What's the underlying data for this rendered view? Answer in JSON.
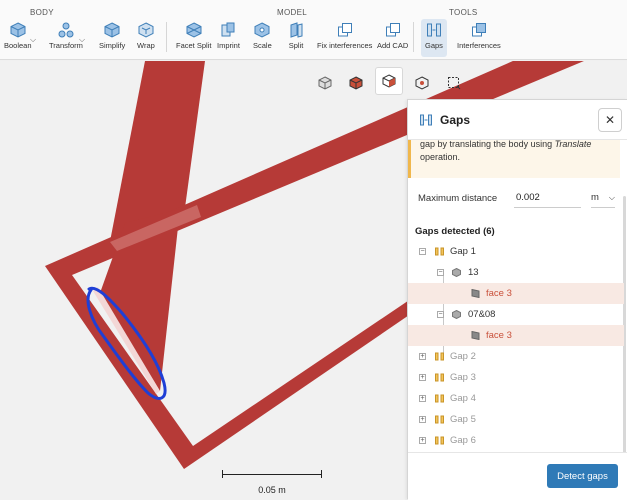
{
  "toolbar": {
    "groups": {
      "body": "BODY",
      "model": "MODEL",
      "tools": "TOOLS"
    },
    "tools": {
      "boolean": "Boolean",
      "transform": "Transform",
      "simplify": "Simplify",
      "wrap": "Wrap",
      "facet_split": "Facet Split",
      "imprint": "Imprint",
      "scale": "Scale",
      "split": "Split",
      "fix_interferences": "Fix interferences",
      "add_cad": "Add CAD",
      "gaps": "Gaps",
      "interferences": "Interferences"
    },
    "active_tool": "gaps"
  },
  "viewport": {
    "view_buttons": [
      "view-cube-icon",
      "solid-body-icon",
      "face-select-icon",
      "vertex-select-icon",
      "box-select-icon"
    ],
    "active_view_button": "face-select-icon",
    "scale_label": "0.05 m",
    "body_color": "#b63a37",
    "annotation_color": "#1f3fd6"
  },
  "panel": {
    "title": "Gaps",
    "close_label": "✕",
    "info_text_1": "gap by translating the body using ",
    "info_text_em": "Translate",
    "info_text_2": "operation.",
    "max_distance_label": "Maximum distance",
    "max_distance_value": "0.002",
    "unit": "m",
    "gaps_detected_label": "Gaps detected (6)",
    "tree": {
      "gap1": "Gap 1",
      "body_a": "13",
      "body_a_face": "face 3",
      "body_b": "07&08",
      "body_b_face": "face 3",
      "gap2": "Gap 2",
      "gap3": "Gap 3",
      "gap4": "Gap 4",
      "gap5": "Gap 5",
      "gap6": "Gap 6"
    },
    "detect_button": "Detect gaps",
    "accent_color": "#2f7ab7"
  }
}
